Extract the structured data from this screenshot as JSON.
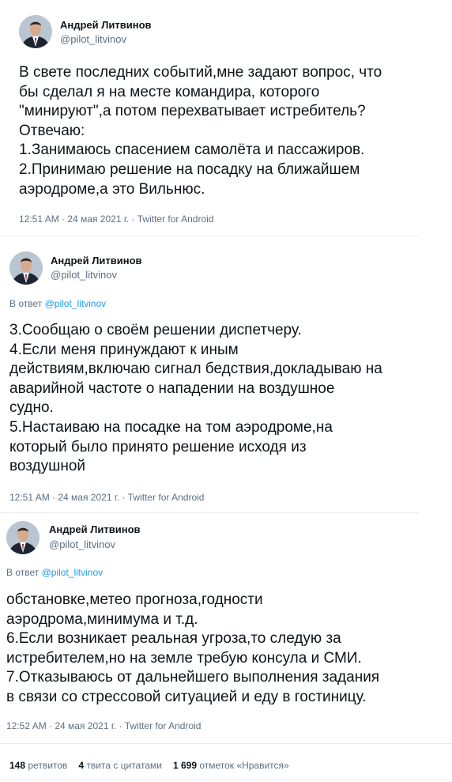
{
  "tweet1": {
    "author_name": "Андрей Литвинов",
    "author_handle": "@pilot_litvinov",
    "lines": [
      "В свете последних событий,мне задают вопрос, что",
      "бы сделал я на месте командира, которого",
      "\"минируют\",а потом перехватывает истребитель?",
      "Отвечаю:",
      "1.Занимаюсь спасением самолёта и пассажиров.",
      "2.Принимаю решение на посадку на ближайшем",
      "аэродроме,а это Вильнюс."
    ],
    "meta": "12:51 AM · 24 мая 2021 г. · Twitter for Android"
  },
  "tweet2": {
    "author_name": "Андрей Литвинов",
    "author_handle": "@pilot_litvinov",
    "reply_prefix": "В ответ ",
    "reply_to": "@pilot_litvinov",
    "lines": [
      "3.Сообщаю о своём решении диспетчеру.",
      "4.Если меня принуждают к иным",
      "действиям,включаю сигнал бедствия,докладываю на",
      "аварийной частоте о нападении на воздушное",
      "судно.",
      "5.Настаиваю на посадке на том аэродроме,на",
      "который было принято решение исходя из",
      "воздушной"
    ],
    "meta": "12:51 AM · 24 мая 2021 г. · Twitter for Android"
  },
  "tweet3": {
    "author_name": "Андрей Литвинов",
    "author_handle": "@pilot_litvinov",
    "reply_prefix": "В ответ ",
    "reply_to": "@pilot_litvinov",
    "lines": [
      "обстановке,метео прогноза,годности",
      "аэродрома,минимума и т.д.",
      "6.Если возникает реальная угроза,то следую за",
      "истребителем,но на земле требую консула и СМИ.",
      "7.Отказываюсь от дальнейшего выполнения задания",
      "в связи со стрессовой ситуацией и еду в гостиницу."
    ],
    "meta": "12:52 AM · 24 мая 2021 г. · Twitter for Android"
  },
  "stats": {
    "retweets_count": "148",
    "retweets_label": "ретвитов",
    "quotes_count": "4",
    "quotes_label": "твита с цитатами",
    "likes_count": "1 699",
    "likes_label": "отметок «Нравится»"
  },
  "colors": {
    "text": "#0f1419",
    "secondary": "#5b7083",
    "link": "#1d9bf0",
    "divider": "#e6ecf0"
  }
}
